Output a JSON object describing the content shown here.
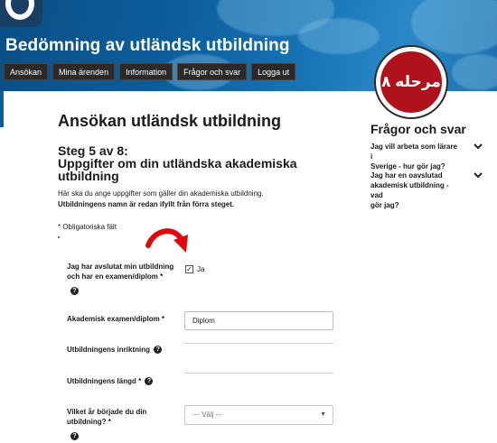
{
  "header": {
    "site_title": "Bedömning av utländsk utbildning",
    "nav": [
      "Ansökan",
      "Mina ärenden",
      "Information",
      "Frågor och svar",
      "Logga ut"
    ]
  },
  "badge": {
    "text": "مرحله ۸",
    "color": "#b0121b"
  },
  "main": {
    "page_title": "Ansökan utländsk utbildning",
    "step_line1": "Steg 5 av 8:",
    "step_line2": "Uppgifter om din utländska akademiska",
    "step_line3": "utbildning",
    "intro_text": "Här ska du ange uppgifter som gäller din akademiska utbildning.",
    "intro_bold": "Utbildningens namn är redan ifyllt från förra steget.",
    "required_note": "* Obligatoriska fält",
    "fields": {
      "completed": {
        "label_line1": "Jag har avslutat min utbildning",
        "label_line2": "och har en examen/diplom *",
        "checkbox_label": "Ja",
        "checked": true
      },
      "degree": {
        "label": "Akademisk examen/diplom *",
        "value": "Diplom"
      },
      "orientation": {
        "label": "Utbildningens inriktning",
        "value": ""
      },
      "length": {
        "label": "Utbildningens längd *",
        "value": ""
      },
      "start_year": {
        "label_line1": "Vilket år började du din",
        "label_line2": "utbildning? *",
        "selected": "--- Välj ---"
      }
    }
  },
  "sidebar": {
    "title": "Frågor och svar",
    "items": [
      {
        "line1": "Jag vill arbeta som lärare i",
        "line2": "Sverige - hur gör jag?"
      },
      {
        "line1": "Jag har en oavslutad",
        "line2": "akademisk utbildning - vad",
        "line3": "gör jag?"
      }
    ]
  },
  "icons": {
    "help": "help-icon",
    "chevron": "chevron-down-icon",
    "arrow": "red-arrow-icon"
  }
}
